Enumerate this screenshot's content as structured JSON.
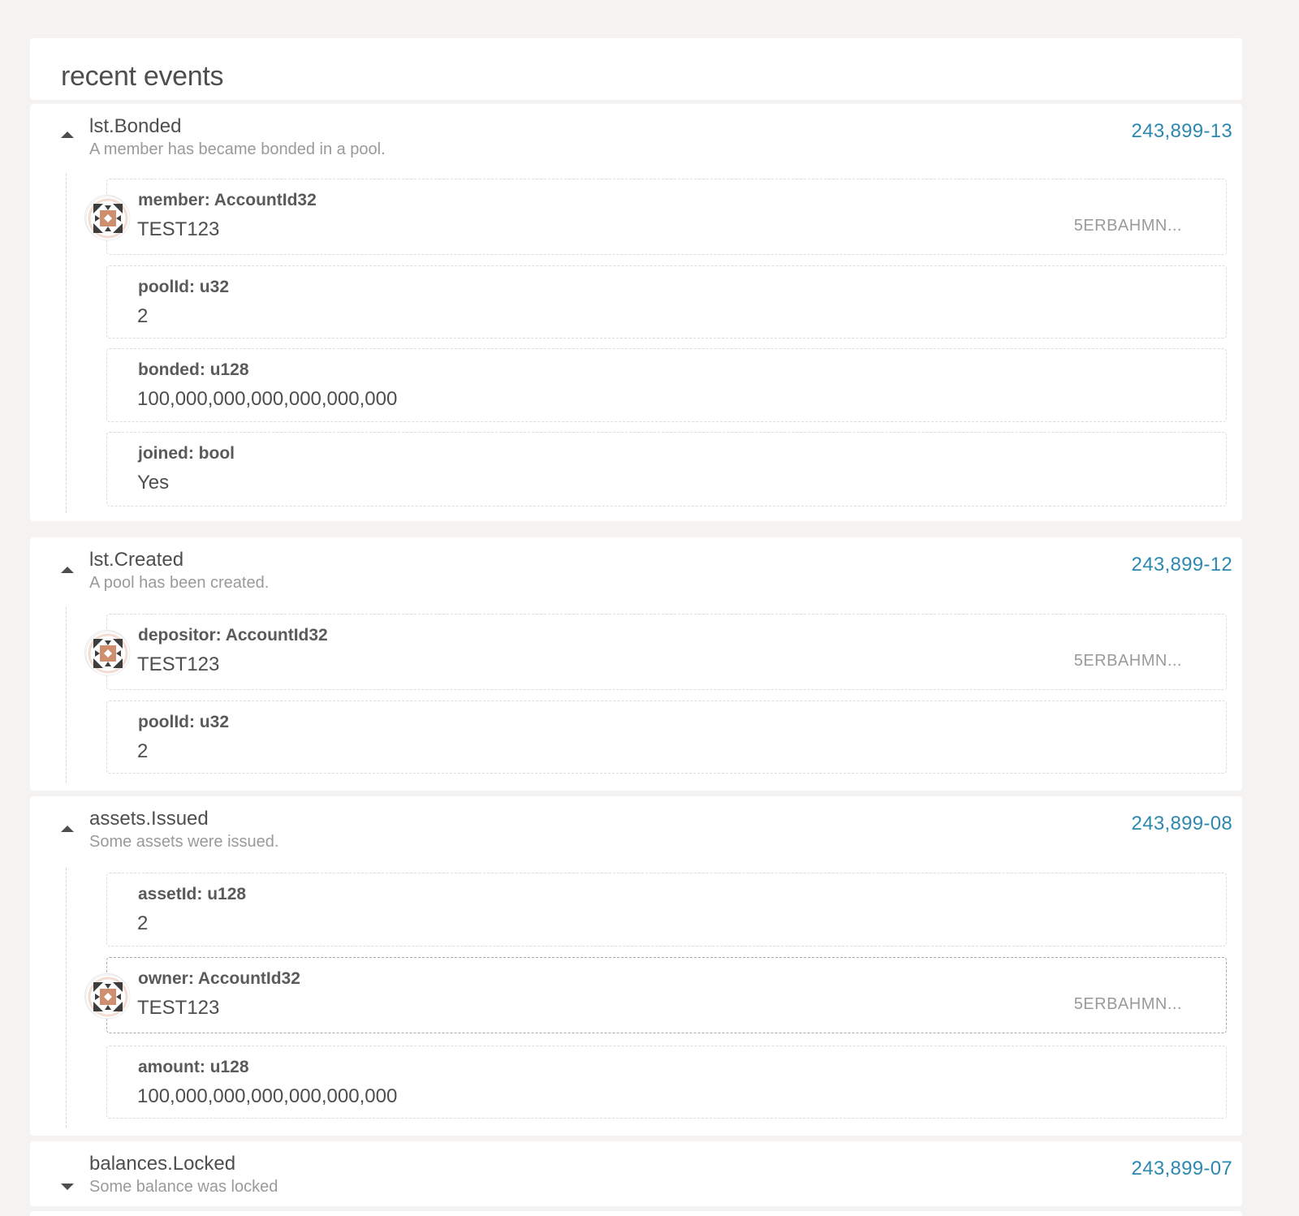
{
  "header": {
    "title": "recent events"
  },
  "events": [
    {
      "title": "lst.Bonded",
      "description": "A member has became bonded in a pool.",
      "link": "243,899-13",
      "expanded": true,
      "params": [
        {
          "label": "member: AccountId32",
          "value": "TEST123",
          "address": "5ERBAHMN...",
          "has_avatar": true
        },
        {
          "label": "poolId: u32",
          "value": "2"
        },
        {
          "label": "bonded: u128",
          "value": "100,000,000,000,000,000,000"
        },
        {
          "label": "joined: bool",
          "value": "Yes"
        }
      ]
    },
    {
      "title": "lst.Created",
      "description": "A pool has been created.",
      "link": "243,899-12",
      "expanded": true,
      "params": [
        {
          "label": "depositor: AccountId32",
          "value": "TEST123",
          "address": "5ERBAHMN...",
          "has_avatar": true
        },
        {
          "label": "poolId: u32",
          "value": "2"
        }
      ]
    },
    {
      "title": "assets.Issued",
      "description": "Some assets were issued.",
      "link": "243,899-08",
      "expanded": true,
      "params": [
        {
          "label": "assetId: u128",
          "value": "2"
        },
        {
          "label": "owner: AccountId32",
          "value": "TEST123",
          "address": "5ERBAHMN...",
          "has_avatar": true,
          "highlighted": true
        },
        {
          "label": "amount: u128",
          "value": "100,000,000,000,000,000,000"
        }
      ]
    },
    {
      "title": "balances.Locked",
      "description": "Some balance was locked",
      "link": "243,899-07",
      "expanded": false,
      "params": []
    }
  ],
  "colors": {
    "background": "#f4f3f1",
    "link": "#2d88b0",
    "muted": "#9a9a9a",
    "text": "#4e4e4e",
    "avatar_accent": "#cf8f6e"
  },
  "icons": {
    "expanded": "caret-up-icon",
    "collapsed": "caret-down-icon",
    "account": "identicon-avatar"
  }
}
